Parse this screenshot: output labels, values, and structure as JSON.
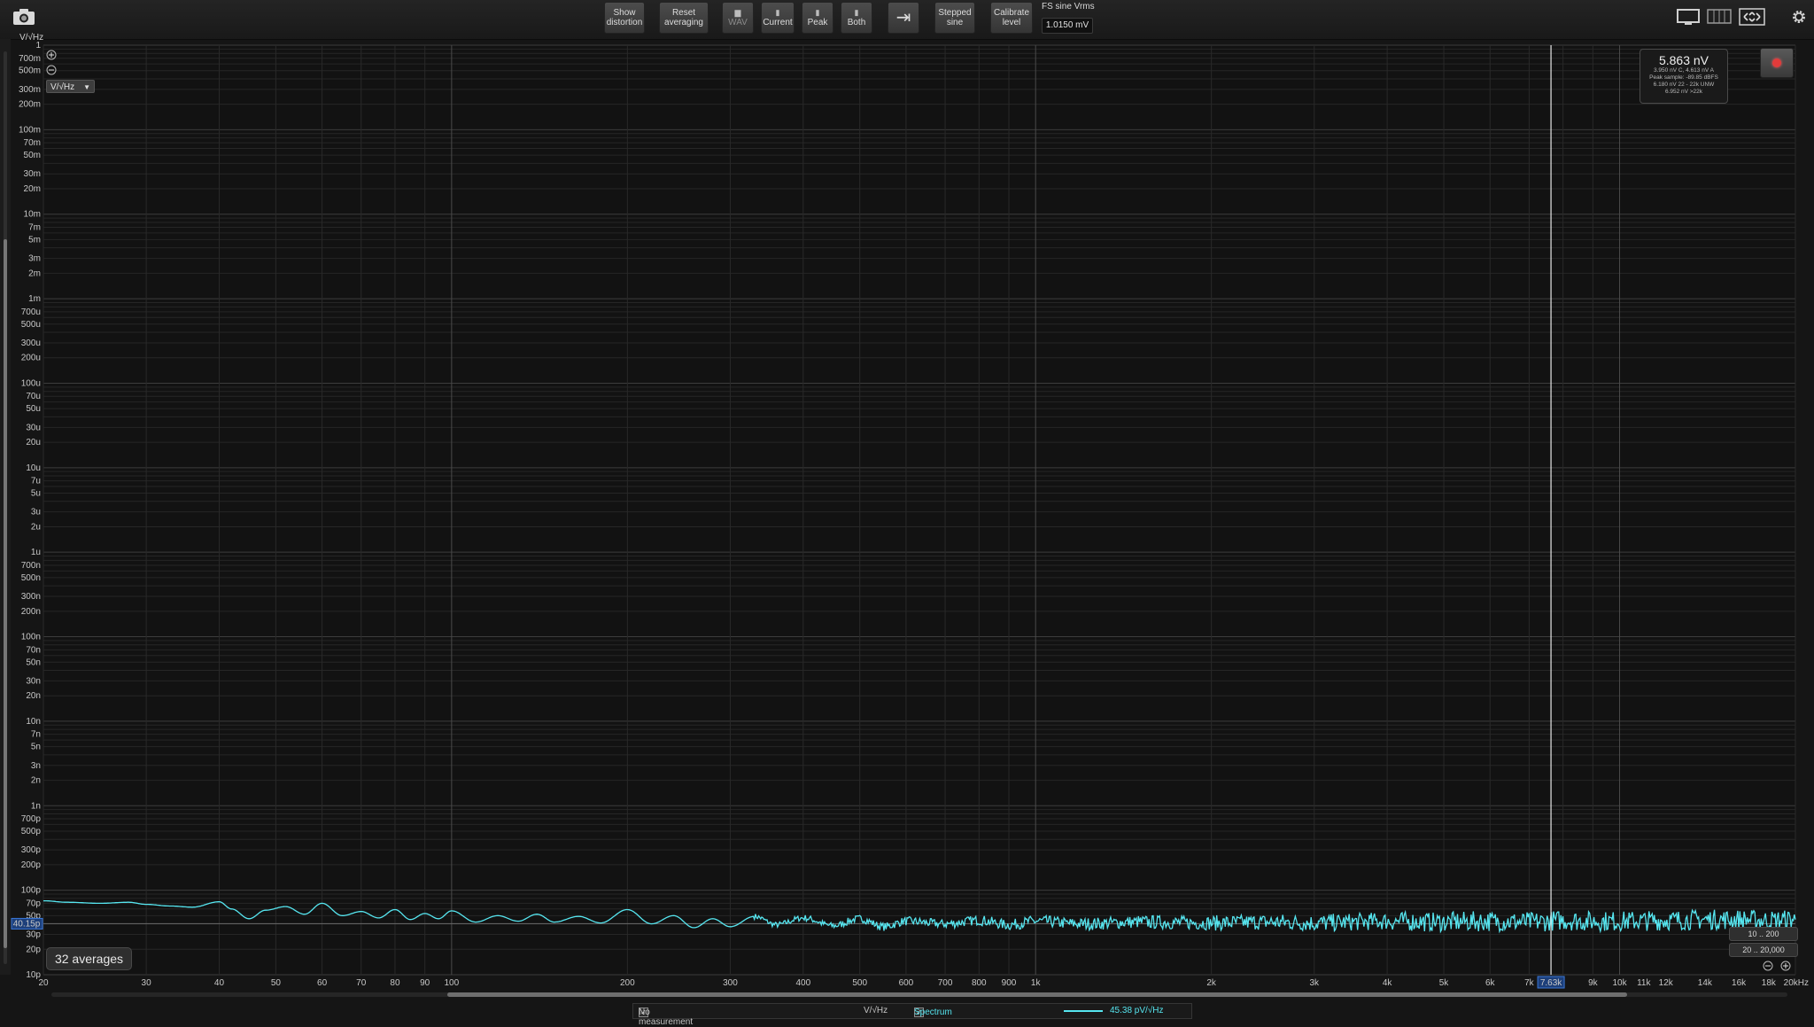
{
  "toolbar": {
    "buttons": [
      {
        "label1": "Show",
        "label2": "distortion",
        "glyph": ""
      },
      {
        "label1": "Reset",
        "label2": "averaging",
        "glyph": ""
      },
      {
        "label1": "WAV",
        "label2": "",
        "glyph": "▆"
      },
      {
        "label1": "Current",
        "label2": "",
        "glyph": "▮"
      },
      {
        "label1": "Peak",
        "label2": "",
        "glyph": "▮"
      },
      {
        "label1": "Both",
        "label2": "",
        "glyph": "▮"
      },
      {
        "label1": "",
        "label2": "",
        "glyph": "⇥"
      },
      {
        "label1": "Stepped",
        "label2": "sine",
        "glyph": ""
      },
      {
        "label1": "Calibrate",
        "label2": "level",
        "glyph": ""
      }
    ],
    "fs_label": "FS sine Vrms",
    "fs_value": "1.0150 mV",
    "icons": [
      "camera-icon",
      "single-window-icon",
      "multi-window-icon",
      "fit-screen-icon",
      "settings-gear-icon"
    ]
  },
  "plot": {
    "unit_label": "V/√Hz",
    "unit_select": "V/√Hz",
    "readout": {
      "main": "5.863 nV",
      "lines": [
        "3.950 nV C, 4.613 nV A",
        "Peak sample: -89.85 dBFS",
        "6.180 nV 22 - 22k UNW",
        "6.952 nV >22k"
      ]
    },
    "cursor_label": "7.63k",
    "y_cursor_label": "40.15p",
    "averages": "32 averages",
    "range1": "10 .. 200",
    "range2": "20 .. 20,000"
  },
  "status": {
    "no_measurement": "No measurement",
    "units": "V/√Hz",
    "spectrum": "Spectrum",
    "spectrum_value": "45.38 pV/√Hz"
  },
  "colors": {
    "trace": "#56e6f0",
    "background": "#151515",
    "grid": "#2a2a2a",
    "accent": "#3a78d8"
  },
  "chart_data": {
    "type": "line",
    "title": "",
    "xlabel": "",
    "ylabel": "V/√Hz",
    "x_scale": "log",
    "y_scale": "log",
    "xlim": [
      20,
      20000
    ],
    "ylim": [
      1e-11,
      1
    ],
    "x_tick_labels": [
      {
        "v": 20,
        "t": "20"
      },
      {
        "v": 30,
        "t": "30"
      },
      {
        "v": 40,
        "t": "40"
      },
      {
        "v": 50,
        "t": "50"
      },
      {
        "v": 60,
        "t": "60"
      },
      {
        "v": 70,
        "t": "70"
      },
      {
        "v": 80,
        "t": "80"
      },
      {
        "v": 90,
        "t": "90"
      },
      {
        "v": 100,
        "t": "100"
      },
      {
        "v": 200,
        "t": "200"
      },
      {
        "v": 300,
        "t": "300"
      },
      {
        "v": 400,
        "t": "400"
      },
      {
        "v": 500,
        "t": "500"
      },
      {
        "v": 600,
        "t": "600"
      },
      {
        "v": 700,
        "t": "700"
      },
      {
        "v": 800,
        "t": "800"
      },
      {
        "v": 900,
        "t": "900"
      },
      {
        "v": 1000,
        "t": "1k"
      },
      {
        "v": 2000,
        "t": "2k"
      },
      {
        "v": 3000,
        "t": "3k"
      },
      {
        "v": 4000,
        "t": "4k"
      },
      {
        "v": 5000,
        "t": "5k"
      },
      {
        "v": 6000,
        "t": "6k"
      },
      {
        "v": 7000,
        "t": "7k"
      },
      {
        "v": 9000,
        "t": "9k"
      },
      {
        "v": 10000,
        "t": "10k"
      },
      {
        "v": 11000,
        "t": "11k"
      },
      {
        "v": 12000,
        "t": "12k"
      },
      {
        "v": 14000,
        "t": "14k"
      },
      {
        "v": 16000,
        "t": "16k"
      },
      {
        "v": 18000,
        "t": "18k"
      },
      {
        "v": 20000,
        "t": "20kHz"
      }
    ],
    "y_tick_labels": [
      {
        "v": 1,
        "t": "1"
      },
      {
        "v": 0.7,
        "t": "700m"
      },
      {
        "v": 0.5,
        "t": "500m"
      },
      {
        "v": 0.3,
        "t": "300m"
      },
      {
        "v": 0.2,
        "t": "200m"
      },
      {
        "v": 0.1,
        "t": "100m"
      },
      {
        "v": 0.07,
        "t": "70m"
      },
      {
        "v": 0.05,
        "t": "50m"
      },
      {
        "v": 0.03,
        "t": "30m"
      },
      {
        "v": 0.02,
        "t": "20m"
      },
      {
        "v": 0.01,
        "t": "10m"
      },
      {
        "v": 0.007,
        "t": "7m"
      },
      {
        "v": 0.005,
        "t": "5m"
      },
      {
        "v": 0.003,
        "t": "3m"
      },
      {
        "v": 0.002,
        "t": "2m"
      },
      {
        "v": 0.001,
        "t": "1m"
      },
      {
        "v": 0.0007,
        "t": "700u"
      },
      {
        "v": 0.0005,
        "t": "500u"
      },
      {
        "v": 0.0003,
        "t": "300u"
      },
      {
        "v": 0.0002,
        "t": "200u"
      },
      {
        "v": 0.0001,
        "t": "100u"
      },
      {
        "v": 7e-05,
        "t": "70u"
      },
      {
        "v": 5e-05,
        "t": "50u"
      },
      {
        "v": 3e-05,
        "t": "30u"
      },
      {
        "v": 2e-05,
        "t": "20u"
      },
      {
        "v": 1e-05,
        "t": "10u"
      },
      {
        "v": 7e-06,
        "t": "7u"
      },
      {
        "v": 5e-06,
        "t": "5u"
      },
      {
        "v": 3e-06,
        "t": "3u"
      },
      {
        "v": 2e-06,
        "t": "2u"
      },
      {
        "v": 1e-06,
        "t": "1u"
      },
      {
        "v": 7e-07,
        "t": "700n"
      },
      {
        "v": 5e-07,
        "t": "500n"
      },
      {
        "v": 3e-07,
        "t": "300n"
      },
      {
        "v": 2e-07,
        "t": "200n"
      },
      {
        "v": 1e-07,
        "t": "100n"
      },
      {
        "v": 7e-08,
        "t": "70n"
      },
      {
        "v": 5e-08,
        "t": "50n"
      },
      {
        "v": 3e-08,
        "t": "30n"
      },
      {
        "v": 2e-08,
        "t": "20n"
      },
      {
        "v": 1e-08,
        "t": "10n"
      },
      {
        "v": 7e-09,
        "t": "7n"
      },
      {
        "v": 5e-09,
        "t": "5n"
      },
      {
        "v": 3e-09,
        "t": "3n"
      },
      {
        "v": 2e-09,
        "t": "2n"
      },
      {
        "v": 1e-09,
        "t": "1n"
      },
      {
        "v": 7e-10,
        "t": "700p"
      },
      {
        "v": 5e-10,
        "t": "500p"
      },
      {
        "v": 3e-10,
        "t": "300p"
      },
      {
        "v": 2e-10,
        "t": "200p"
      },
      {
        "v": 1e-10,
        "t": "100p"
      },
      {
        "v": 7e-11,
        "t": "70p"
      },
      {
        "v": 5e-11,
        "t": "50p"
      },
      {
        "v": 3e-11,
        "t": "30p"
      },
      {
        "v": 2e-11,
        "t": "20p"
      },
      {
        "v": 1e-11,
        "t": "10p"
      }
    ],
    "cursor_x": 7630,
    "y_marker": 4.015e-11,
    "series": [
      {
        "name": "Spectrum",
        "color": "#56e6f0",
        "x": [
          20,
          22,
          25,
          28,
          30,
          33,
          36,
          40,
          42,
          45,
          48,
          52,
          56,
          60,
          65,
          70,
          75,
          80,
          85,
          90,
          95,
          100,
          110,
          120,
          130,
          140,
          150,
          165,
          180,
          200,
          220,
          240,
          260,
          280,
          300,
          330,
          360,
          400,
          450,
          500,
          550,
          600,
          700,
          800,
          900,
          1000,
          1200,
          1500,
          2000,
          2500,
          3000,
          4000,
          5000,
          6000,
          7000,
          8000,
          9000,
          10000,
          12000,
          14000,
          16000,
          18000,
          20000
        ],
        "y": [
          7.5e-11,
          7.2e-11,
          7e-11,
          7.2e-11,
          6.8e-11,
          6.5e-11,
          6.3e-11,
          7.3e-11,
          6e-11,
          4.6e-11,
          5.8e-11,
          6.4e-11,
          5.2e-11,
          7e-11,
          5e-11,
          5.6e-11,
          4.7e-11,
          5.9e-11,
          4.5e-11,
          5.3e-11,
          4.6e-11,
          5.7e-11,
          4.2e-11,
          5e-11,
          4.3e-11,
          5.2e-11,
          4.2e-11,
          4.9e-11,
          4.1e-11,
          5.9e-11,
          4e-11,
          5e-11,
          3.6e-11,
          4.6e-11,
          3.7e-11,
          4.9e-11,
          3.9e-11,
          4.7e-11,
          3.8e-11,
          4.6e-11,
          3.7e-11,
          4.3e-11,
          4e-11,
          4.4e-11,
          3.9e-11,
          4.3e-11,
          4e-11,
          4.2e-11,
          4.1e-11,
          4.2e-11,
          4.1e-11,
          4.3e-11,
          4.2e-11,
          4.3e-11,
          4.2e-11,
          4.4e-11,
          4.3e-11,
          4.3e-11,
          4.4e-11,
          4.5e-11,
          4.5e-11,
          4.4e-11,
          4.5e-11
        ]
      }
    ]
  }
}
